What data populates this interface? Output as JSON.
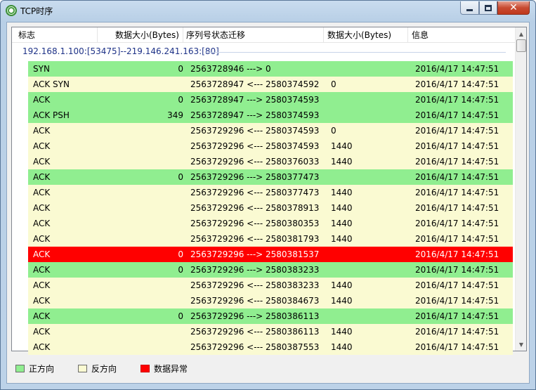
{
  "window": {
    "title": "TCP时序",
    "close_glyph": "✕"
  },
  "columns": [
    "标志",
    "数据大小(Bytes)",
    "序列号状态迁移",
    "数据大小(Bytes)",
    "信息"
  ],
  "group": {
    "label": "192.168.1.100:[53475]--219.146.241.163:[80]"
  },
  "rows": [
    {
      "kind": "fwd",
      "flag": "SYN",
      "size1": "0",
      "transition": "2563728946 ---> 0",
      "size2": "",
      "info": "2016/4/17 14:47:51"
    },
    {
      "kind": "rev",
      "flag": "ACK SYN",
      "size1": "",
      "transition": "2563728947 <--- 2580374592",
      "size2": "0",
      "info": "2016/4/17 14:47:51"
    },
    {
      "kind": "fwd",
      "flag": "ACK",
      "size1": "0",
      "transition": "2563728947 ---> 2580374593",
      "size2": "",
      "info": "2016/4/17 14:47:51"
    },
    {
      "kind": "fwd",
      "flag": "ACK PSH",
      "size1": "349",
      "transition": "2563728947 ---> 2580374593",
      "size2": "",
      "info": "2016/4/17 14:47:51"
    },
    {
      "kind": "rev",
      "flag": "ACK",
      "size1": "",
      "transition": "2563729296 <--- 2580374593",
      "size2": "0",
      "info": "2016/4/17 14:47:51"
    },
    {
      "kind": "rev",
      "flag": "ACK",
      "size1": "",
      "transition": "2563729296 <--- 2580374593",
      "size2": "1440",
      "info": "2016/4/17 14:47:51"
    },
    {
      "kind": "rev",
      "flag": "ACK",
      "size1": "",
      "transition": "2563729296 <--- 2580376033",
      "size2": "1440",
      "info": "2016/4/17 14:47:51"
    },
    {
      "kind": "fwd",
      "flag": "ACK",
      "size1": "0",
      "transition": "2563729296 ---> 2580377473",
      "size2": "",
      "info": "2016/4/17 14:47:51"
    },
    {
      "kind": "rev",
      "flag": "ACK",
      "size1": "",
      "transition": "2563729296 <--- 2580377473",
      "size2": "1440",
      "info": "2016/4/17 14:47:51"
    },
    {
      "kind": "rev",
      "flag": "ACK",
      "size1": "",
      "transition": "2563729296 <--- 2580378913",
      "size2": "1440",
      "info": "2016/4/17 14:47:51"
    },
    {
      "kind": "rev",
      "flag": "ACK",
      "size1": "",
      "transition": "2563729296 <--- 2580380353",
      "size2": "1440",
      "info": "2016/4/17 14:47:51"
    },
    {
      "kind": "rev",
      "flag": "ACK",
      "size1": "",
      "transition": "2563729296 <--- 2580381793",
      "size2": "1440",
      "info": "2016/4/17 14:47:51"
    },
    {
      "kind": "err",
      "flag": "ACK",
      "size1": "0",
      "transition": "2563729296 ---> 2580381537",
      "size2": "",
      "info": "2016/4/17 14:47:51"
    },
    {
      "kind": "fwd",
      "flag": "ACK",
      "size1": "0",
      "transition": "2563729296 ---> 2580383233",
      "size2": "",
      "info": "2016/4/17 14:47:51"
    },
    {
      "kind": "rev",
      "flag": "ACK",
      "size1": "",
      "transition": "2563729296 <--- 2580383233",
      "size2": "1440",
      "info": "2016/4/17 14:47:51"
    },
    {
      "kind": "rev",
      "flag": "ACK",
      "size1": "",
      "transition": "2563729296 <--- 2580384673",
      "size2": "1440",
      "info": "2016/4/17 14:47:51"
    },
    {
      "kind": "fwd",
      "flag": "ACK",
      "size1": "0",
      "transition": "2563729296 ---> 2580386113",
      "size2": "",
      "info": "2016/4/17 14:47:51"
    },
    {
      "kind": "rev",
      "flag": "ACK",
      "size1": "",
      "transition": "2563729296 <--- 2580386113",
      "size2": "1440",
      "info": "2016/4/17 14:47:51"
    },
    {
      "kind": "rev",
      "flag": "ACK",
      "size1": "",
      "transition": "2563729296 <--- 2580387553",
      "size2": "1440",
      "info": "2016/4/17 14:47:51"
    }
  ],
  "legend": {
    "forward": "正方向",
    "reverse": "反方向",
    "error": "数据异常"
  },
  "colors": {
    "forward": "#90ee90",
    "reverse": "#fafad2",
    "error": "#ff0000"
  }
}
